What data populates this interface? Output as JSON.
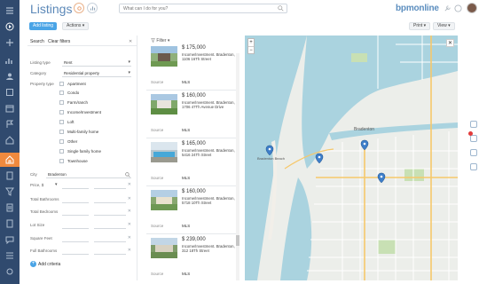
{
  "header": {
    "title": "Listings",
    "search_placeholder": "What can I do for you?",
    "logo": "bpmonline"
  },
  "toolbar": {
    "add_listing": "Add listing",
    "actions": "Actions ▾",
    "print": "Print ▾",
    "view": "View ▾"
  },
  "filter_panel": {
    "search_label": "Search",
    "clear_label": "Clear filters",
    "listing_type": {
      "label": "Listing type",
      "value": "Rent"
    },
    "category": {
      "label": "Category",
      "value": "Residential property"
    },
    "property_type": {
      "label": "Property type",
      "options": [
        "Apartment",
        "Condo",
        "Farm/ranch",
        "Income/Investment",
        "Loft",
        "Multi-family home",
        "Other",
        "Single family home",
        "Townhouse"
      ]
    },
    "city": {
      "label": "City",
      "value": "Bradenton"
    },
    "price": {
      "label": "Price, $"
    },
    "ranges": [
      "Total Bathrooms",
      "Total Bedrooms",
      "Lot Size",
      "Square Feet",
      "Full Bathrooms"
    ],
    "add_criteria": "Add criteria"
  },
  "listings": {
    "filter_label": "Filter ▾",
    "source_label": "Source",
    "items": [
      {
        "price": "$ 175,000",
        "desc": "Income/Investment. Bradenton, 1106 16Th Street",
        "source": "MLS"
      },
      {
        "price": "$ 160,000",
        "desc": "Income/Investment. Bradenton, 1706 47Th Avenue Drive",
        "source": "MLS"
      },
      {
        "price": "$ 165,000",
        "desc": "Income/Investment. Bradenton, 5416 24Th Street",
        "source": "MLS"
      },
      {
        "price": "$ 160,000",
        "desc": "Income/Investment. Bradenton, 5718 10Th Street",
        "source": "MLS"
      },
      {
        "price": "$ 239,000",
        "desc": "Income/Investment. Bradenton, 312 18Th Street",
        "source": "MLS"
      }
    ]
  },
  "map": {
    "labels": {
      "city": "Bradenton",
      "beach": "Bradenton Beach"
    }
  },
  "colors": {
    "nav_bg": "#304a6e",
    "accent": "#f08a3e",
    "primary": "#4aa4e6",
    "title": "#5b88b8",
    "marker": "#3d7ec9"
  }
}
